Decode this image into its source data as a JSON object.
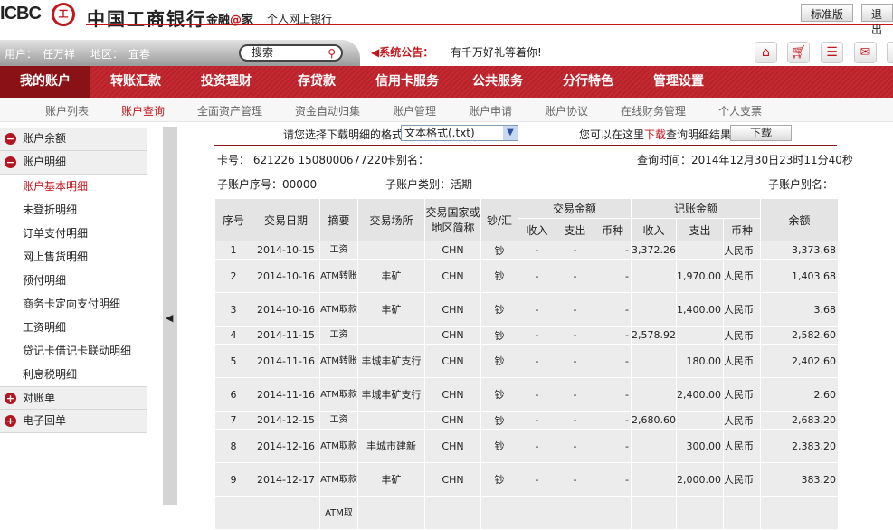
{
  "header": {
    "logo": "ICBC",
    "seal": "工",
    "bank_name": "中国工商银行",
    "slogan_a": "金融",
    "slogan_at": "@",
    "slogan_b": "家",
    "product": "个人网上银行",
    "standard_btn": "标准版",
    "exit_btn": "退出"
  },
  "userbar": {
    "user_label": "用户：",
    "user": "任万祥",
    "region_label": "地区：",
    "region": "宜春",
    "search_placeholder": "搜索",
    "notice_label": "系统公告：",
    "notice": "有千万好礼等着你!"
  },
  "nav": [
    "我的账户",
    "转账汇款",
    "投资理财",
    "存贷款",
    "信用卡服务",
    "公共服务",
    "分行特色",
    "管理设置"
  ],
  "subnav": [
    "账户列表",
    "账户查询",
    "全面资产管理",
    "资金自动归集",
    "账户管理",
    "账户申请",
    "账户协议",
    "在线财务管理",
    "个人支票"
  ],
  "sidebar": {
    "g1": "账户余额",
    "g2": "账户明细",
    "items": [
      "账户基本明细",
      "未登折明细",
      "订单支付明细",
      "网上售货明细",
      "预付明细",
      "商务卡定向支付明细",
      "工资明细",
      "贷记卡借记卡联动明细",
      "利息税明细"
    ],
    "g3": "对账单",
    "g4": "电子回单"
  },
  "download": {
    "prompt": "请您选择下载明细的格式",
    "format": "文本格式(.txt)",
    "hint_a": "您可以在这里",
    "hint_link": "下载",
    "hint_b": "查询明细结果",
    "button": "下载"
  },
  "info": {
    "card": "卡号： 621226 1508000677220",
    "alias": "卡别名：",
    "time": "查询时间：2014年12月30日23时11分40秒",
    "sub_no": "子账户序号：00000",
    "sub_type": "子账户类别：活期",
    "sub_alias": "子账户别名："
  },
  "table": {
    "h": {
      "no": "序号",
      "date": "交易日期",
      "summary": "摘要",
      "place": "交易场所",
      "country": "交易国家或地区简称",
      "cash": "钞/汇",
      "trade": "交易金额",
      "book": "记账金额",
      "in": "收入",
      "out": "支出",
      "cur": "币种",
      "balance": "余额"
    },
    "rows": [
      [
        "1",
        "2014-10-15",
        "工资",
        "",
        "CHN",
        "钞",
        "-",
        "-",
        "-",
        "3,372.26",
        "",
        "人民币",
        "3,373.68"
      ],
      [
        "2",
        "2014-10-16",
        "ATM转账",
        "丰矿",
        "CHN",
        "钞",
        "-",
        "-",
        "-",
        "",
        "1,970.00",
        "人民币",
        "1,403.68"
      ],
      [
        "3",
        "2014-10-16",
        "ATM取款",
        "丰矿",
        "CHN",
        "钞",
        "-",
        "-",
        "-",
        "",
        "1,400.00",
        "人民币",
        "3.68"
      ],
      [
        "4",
        "2014-11-15",
        "工资",
        "",
        "CHN",
        "钞",
        "-",
        "-",
        "-",
        "2,578.92",
        "",
        "人民币",
        "2,582.60"
      ],
      [
        "5",
        "2014-11-16",
        "ATM转账",
        "丰城丰矿支行",
        "CHN",
        "钞",
        "-",
        "-",
        "-",
        "",
        "180.00",
        "人民币",
        "2,402.60"
      ],
      [
        "6",
        "2014-11-16",
        "ATM取款",
        "丰城丰矿支行",
        "CHN",
        "钞",
        "-",
        "-",
        "-",
        "",
        "2,400.00",
        "人民币",
        "2.60"
      ],
      [
        "7",
        "2014-12-15",
        "工资",
        "",
        "CHN",
        "钞",
        "-",
        "-",
        "-",
        "2,680.60",
        "",
        "人民币",
        "2,683.20"
      ],
      [
        "8",
        "2014-12-16",
        "ATM取款",
        "丰城市建新",
        "CHN",
        "钞",
        "-",
        "-",
        "-",
        "",
        "300.00",
        "人民币",
        "2,383.20"
      ],
      [
        "9",
        "2014-12-17",
        "ATM取款",
        "丰矿",
        "CHN",
        "钞",
        "-",
        "-",
        "-",
        "",
        "2,000.00",
        "人民币",
        "383.20"
      ],
      [
        "",
        "",
        "ATM取",
        "",
        "",
        "",
        "",
        "",
        "",
        "",
        "",
        "",
        ""
      ]
    ]
  }
}
